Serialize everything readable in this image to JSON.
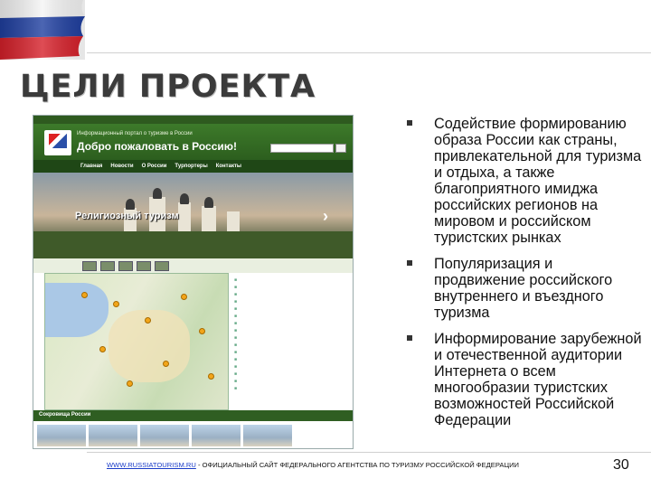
{
  "slide": {
    "title": "ЦЕЛИ ПРОЕКТА",
    "page_number": "30"
  },
  "bullets": [
    "Содействие формированию образа России как страны, привлекательной для туризма и отдыха, а также благоприятного имиджа российских регионов на мировом и российском туристских рынках",
    "Популяризация и продвижение российского внутреннего и въездного туризма",
    "Информирование зарубежной и отечественной аудитории Интернета о всем многообразии туристских возможностей Российской Федерации"
  ],
  "footer": {
    "link": "WWW.RUSSIATOURISM.RU",
    "text": " - ОФИЦИАЛЬНЫЙ САЙТ ФЕДЕРАЛЬНОГО АГЕНТСТВА ПО ТУРИЗМУ РОССИЙСКОЙ ФЕДЕРАЦИИ"
  },
  "website": {
    "portal_name": "Информационный портал о туризме в России",
    "welcome": "Добро пожаловать в Россию!",
    "nav": [
      "Главная",
      "Новости",
      "О России",
      "Турпортеры",
      "Контакты"
    ],
    "banner_caption": "Религиозный туризм",
    "treasures": "Сокровища России"
  },
  "colors": {
    "site_green": "#2c5e1e",
    "link_blue": "#1a3cc8"
  },
  "icons": {
    "flag": "russian-flag-icon",
    "bullet": "square-bullet-icon"
  }
}
